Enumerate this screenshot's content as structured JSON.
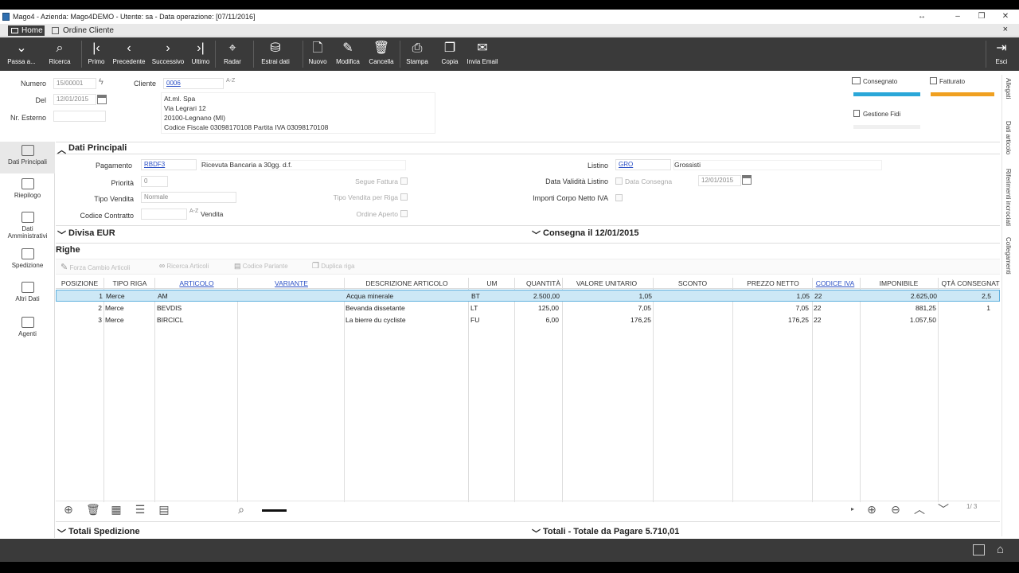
{
  "window": {
    "title": "Mago4 - Azienda: Mago4DEMO - Utente: sa - Data operazione: [07/11/2016]"
  },
  "tabs": {
    "home": "Home",
    "doc": "Ordine Cliente",
    "close": "×"
  },
  "toolbar": {
    "passa": "Passa a...",
    "ricerca": "Ricerca",
    "primo": "Primo",
    "precedente": "Precedente",
    "successivo": "Successivo",
    "ultimo": "Ultimo",
    "radar": "Radar",
    "estrai": "Estrai dati",
    "nuovo": "Nuovo",
    "modifica": "Modifica",
    "cancella": "Cancella",
    "stampa": "Stampa",
    "copia": "Copia",
    "invia": "Invia Email",
    "esci": "Esci"
  },
  "header": {
    "numero_label": "Numero",
    "numero_value": "15/00001",
    "del_label": "Del",
    "del_value": "12/01/2015",
    "nr_esterno_label": "Nr. Esterno",
    "nr_esterno_value": "",
    "cliente_label": "Cliente",
    "cliente_code": "0006",
    "cliente_addr1": "At.ml. Spa",
    "cliente_addr2": "Via Legrari 12",
    "cliente_addr3": "20100-Legnano (MI)",
    "cliente_addr4": "Codice Fiscale 03098170108 Partita IVA 03098170108",
    "consegnato": "Consegnato",
    "fatturato": "Fatturato",
    "gestione_fidi": "Gestione Fidi",
    "colors": {
      "consegnato": "#2aa7d8",
      "fatturato": "#f0a020"
    }
  },
  "leftnav": {
    "dati_principali": "Dati Principali",
    "riepilogo": "Riepilogo",
    "dati_amm1": "Dati",
    "dati_amm2": "Amministrativi",
    "spedizione": "Spedizione",
    "altri_dati": "Altri Dati",
    "agenti": "Agenti"
  },
  "rightnav": {
    "allegati": "Allegati",
    "dati_articolo": "Dati articolo",
    "riferimenti": "Riferimenti incrociati",
    "collegamenti": "Collegamenti"
  },
  "dati_principali": {
    "title": "Dati Principali",
    "pagamento_label": "Pagamento",
    "pagamento_code": "RBDF3",
    "pagamento_desc": "Ricevuta Bancaria a 30gg. d.f.",
    "priorita_label": "Priorità",
    "priorita_value": "0",
    "tipo_vendita_label": "Tipo Vendita",
    "tipo_vendita_value": "Normale",
    "codice_contratto_label": "Codice Contratto",
    "vendita": "Vendita",
    "segue_fattura": "Segue Fattura",
    "tipo_vendita_riga": "Tipo Vendita per Riga",
    "ordine_aperto": "Ordine Aperto",
    "listino_label": "Listino",
    "listino_code": "GRO",
    "listino_desc": "Grossisti",
    "data_validita_label": "Data Validità Listino",
    "data_consegna": "Data Consegna",
    "data_validita_value": "12/01/2015",
    "importi_label": "Importi Corpo Netto IVA"
  },
  "sections": {
    "divisa": "Divisa EUR",
    "consegna": "Consegna il 12/01/2015",
    "righe": "Righe",
    "totali_spedizione": "Totali Spedizione",
    "totali": "Totali - Totale da Pagare 5.710,01"
  },
  "grid_toolbar": {
    "forza": "Forza Cambio Articoli",
    "ricerca": "Ricerca Articoli",
    "codice": "Codice Parlante",
    "duplica": "Duplica riga"
  },
  "grid": {
    "headers": [
      "POSIZIONE",
      "TIPO RIGA",
      "ARTICOLO",
      "VARIANTE",
      "DESCRIZIONE ARTICOLO",
      "UM",
      "QUANTITÀ",
      "VALORE UNITARIO",
      "SCONTO",
      "PREZZO NETTO",
      "CODICE IVA",
      "IMPONIBILE",
      "QTÀ CONSEGNAT"
    ],
    "rows": [
      [
        "1",
        "Merce",
        "AM",
        "",
        "Acqua minerale",
        "BT",
        "2.500,00",
        "1,05",
        "",
        "1,05",
        "22",
        "2.625,00",
        "2,5"
      ],
      [
        "2",
        "Merce",
        "BEVDIS",
        "",
        "Bevanda dissetante",
        "LT",
        "125,00",
        "7,05",
        "",
        "7,05",
        "22",
        "881,25",
        "1"
      ],
      [
        "3",
        "Merce",
        "BIRCICL",
        "",
        "La bierre du cycliste",
        "FU",
        "6,00",
        "176,25",
        "",
        "176,25",
        "22",
        "1.057,50",
        ""
      ]
    ],
    "pager": "1/ 3"
  }
}
